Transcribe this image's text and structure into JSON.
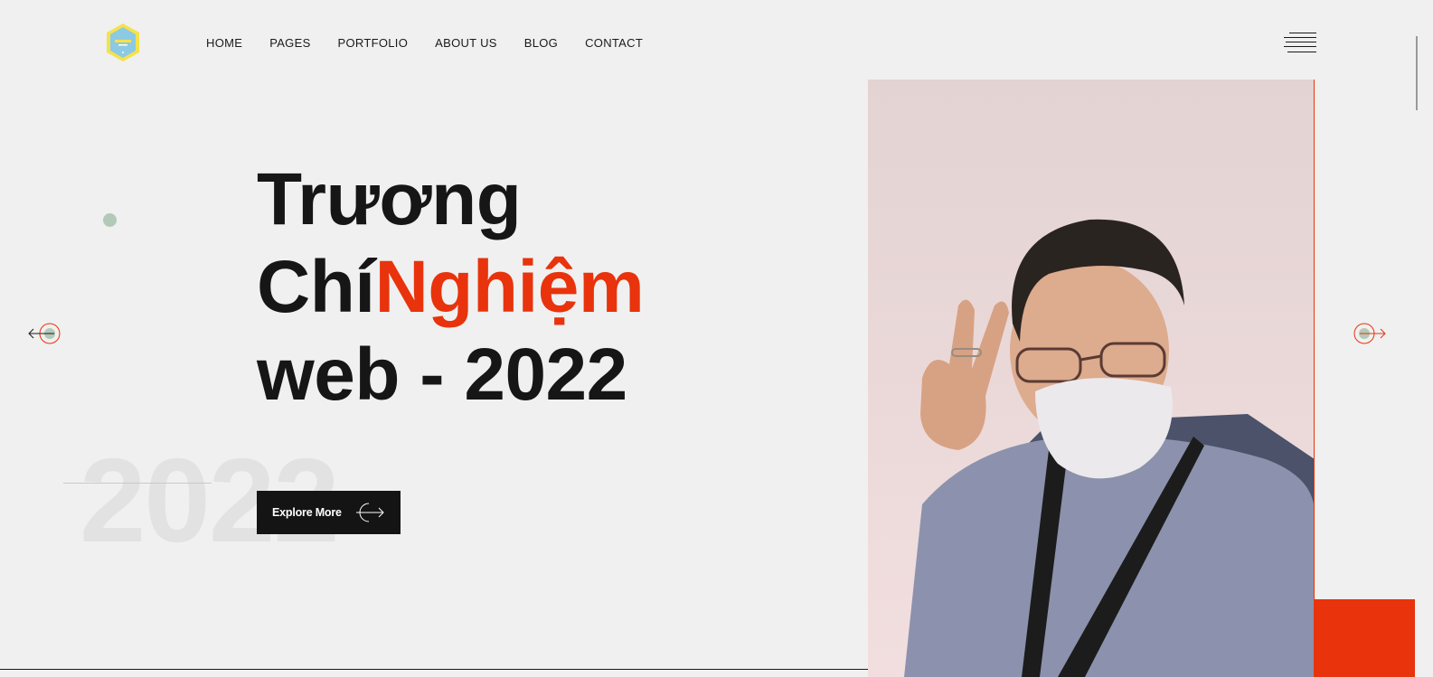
{
  "header": {
    "logo_alt": "logo",
    "nav": [
      {
        "label": "HOME"
      },
      {
        "label": "PAGES"
      },
      {
        "label": "PORTFOLIO"
      },
      {
        "label": "ABOUT US"
      },
      {
        "label": "BLOG"
      },
      {
        "label": "CONTACT"
      }
    ],
    "menu_icon": "hamburger-menu-icon"
  },
  "hero": {
    "line1": "Trương",
    "line2_part1": "Chí",
    "line2_accent": "Nghiệm",
    "line3": "web - 2022",
    "background_year": "2022",
    "cta_label": "Explore More"
  },
  "slider": {
    "prev_icon": "arrow-left-icon",
    "next_icon": "arrow-right-icon"
  },
  "colors": {
    "accent": "#e8330c",
    "text": "#161616",
    "background": "#f0f0f0",
    "dot": "#b3c9b7",
    "cta_bg": "#141414"
  }
}
